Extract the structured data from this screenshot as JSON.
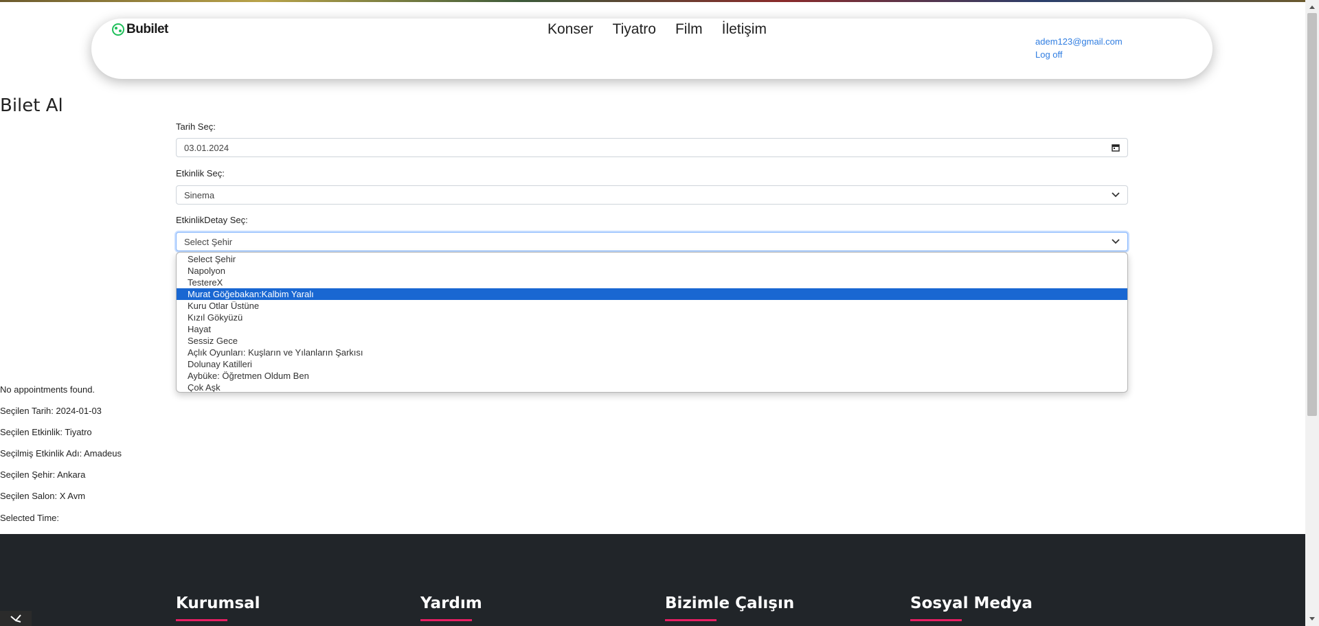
{
  "header": {
    "logo_text": "Bubilet",
    "nav": [
      "Konser",
      "Tiyatro",
      "Film",
      "İletişim"
    ],
    "user_email": "adem123@gmail.com",
    "logoff_label": "Log off"
  },
  "page": {
    "title": "Bilet Al"
  },
  "form": {
    "date_label": "Tarih Seç:",
    "date_value": "03.01.2024",
    "event_label": "Etkinlik Seç:",
    "event_value": "Sinema",
    "detail_label": "EtkinlikDetay Seç:",
    "detail_value": "Select Şehir",
    "options": [
      "Select Şehir",
      "Napolyon",
      "TestereX",
      "Murat Göğebakan:Kalbim Yaralı",
      "Kuru Otlar Üstüne",
      "Kızıl Gökyüzü",
      "Hayat",
      "Sessiz Gece",
      "Açlık Oyunları: Kuşların ve Yılanların Şarkısı",
      "Dolunay Katilleri",
      "Aybüke: Öğretmen Oldum Ben",
      "Çok Aşk"
    ],
    "highlighted_option": "Murat Göğebakan:Kalbim Yaralı"
  },
  "info": {
    "no_appointments": "No appointments found.",
    "selected_date": "Seçilen Tarih: 2024-01-03",
    "selected_event": "Seçilen Etkinlik: Tiyatro",
    "selected_event_name": "Seçilmiş Etkinlik Adı: Amadeus",
    "selected_city": "Seçilen Şehir: Ankara",
    "selected_hall": "Seçilen Salon: X Avm",
    "selected_time": "Selected Time:"
  },
  "footer": {
    "columns": [
      "Kurumsal",
      "Yardım",
      "Bizimle Çalışın",
      "Sosyal Medya"
    ],
    "accent_color": "#e91e63",
    "bg_color": "#212529"
  },
  "colors": {
    "link": "#2f7de1",
    "selection": "#1967d2"
  }
}
